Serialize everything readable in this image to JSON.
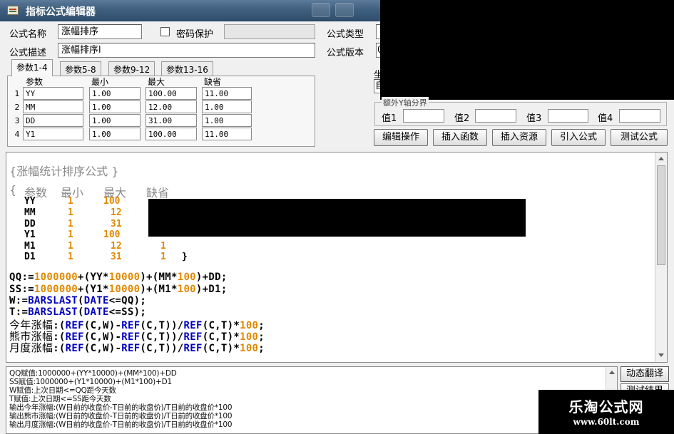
{
  "window": {
    "title": "指标公式编辑器"
  },
  "form": {
    "name_label": "公式名称",
    "name_value": "涨幅排序",
    "password_label": "密码保护",
    "type_label": "公式类型",
    "desc_label": "公式描述",
    "desc_value": "涨幅排序l",
    "version_label": "公式版本",
    "version_partial": "0",
    "side_label_partial": "坐",
    "side_field_partial": "自"
  },
  "tabs": [
    {
      "label": "参数1-4",
      "active": true
    },
    {
      "label": "参数5-8",
      "active": false
    },
    {
      "label": "参数9-12",
      "active": false
    },
    {
      "label": "参数13-16",
      "active": false
    }
  ],
  "params": {
    "headers": [
      "参数",
      "最小",
      "最大",
      "缺省"
    ],
    "rows": [
      {
        "num": "1",
        "name": "YY",
        "min": "1.00",
        "max": "100.00",
        "default": "11.00"
      },
      {
        "num": "2",
        "name": "MM",
        "min": "1.00",
        "max": "12.00",
        "default": "1.00"
      },
      {
        "num": "3",
        "name": "DD",
        "min": "1.00",
        "max": "31.00",
        "default": "1.00"
      },
      {
        "num": "4",
        "name": "Y1",
        "min": "1.00",
        "max": "100.00",
        "default": "11.00"
      }
    ]
  },
  "axis_group": {
    "legend": "额外Y轴分界",
    "values": [
      "值1",
      "值2",
      "值3",
      "值4"
    ]
  },
  "buttons": {
    "edit": "编辑操作",
    "insert_func": "插入函数",
    "insert_res": "插入资源",
    "import": "引入公式",
    "test": "测试公式",
    "dynamic_translate": "动态翻译",
    "test_result_partial": "测试结果"
  },
  "editor": {
    "comment_title": "{涨幅统计排序公式 }",
    "param_header": {
      "open": "{",
      "cols": [
        "参数",
        "最小",
        "最大",
        "缺省"
      ]
    },
    "param_rows": [
      {
        "name": "YY",
        "min": "1",
        "max": "100",
        "def": ""
      },
      {
        "name": "MM",
        "min": "1",
        "max": "12",
        "def": ""
      },
      {
        "name": "DD",
        "min": "1",
        "max": "31",
        "def": ""
      },
      {
        "name": "Y1",
        "min": "1",
        "max": "100",
        "def": ""
      },
      {
        "name": "M1",
        "min": "1",
        "max": "12",
        "def": "1"
      },
      {
        "name": "D1",
        "min": "1",
        "max": "31",
        "def": "1"
      }
    ],
    "param_close": "}",
    "code": {
      "qq": {
        "a": "QQ:=",
        "n1": "1000000",
        "b": "+(YY*",
        "n2": "10000",
        "c": ")+(MM*",
        "n3": "100",
        "d": ")+DD;"
      },
      "ss": {
        "a": "SS:=",
        "n1": "1000000",
        "b": "+(Y1*",
        "n2": "10000",
        "c": ")+(M1*",
        "n3": "100",
        "d": ")+D1;"
      },
      "w": {
        "a": "W:=",
        "f": "BARSLAST",
        "b": "(",
        "g": "DATE",
        "c": "<=QQ);"
      },
      "t": {
        "a": "T:=",
        "f": "BARSLAST",
        "b": "(",
        "g": "DATE",
        "c": "<=SS);"
      },
      "l1": {
        "cn": "今年涨幅",
        "a": ":(",
        "f1": "REF",
        "b": "(C,W)-",
        "f2": "REF",
        "c": "(C,T))/",
        "f3": "REF",
        "d": "(C,T)*",
        "n": "100",
        "e": ";"
      },
      "l2": {
        "cn": "熊市涨幅",
        "a": ":(",
        "f1": "REF",
        "b": "(C,W)-",
        "f2": "REF",
        "c": "(C,T))/",
        "f3": "REF",
        "d": "(C,T)*",
        "n": "100",
        "e": ";"
      },
      "l3": {
        "cn": "月度涨幅",
        "a": ":(",
        "f1": "REF",
        "b": "(C,W)-",
        "f2": "REF",
        "c": "(C,T))/",
        "f3": "REF",
        "d": "(C,T)*",
        "n": "100",
        "e": ";"
      }
    }
  },
  "output_lines": [
    "QQ赋值:1000000+(YY*10000)+(MM*100)+DD",
    "SS赋值:1000000+(Y1*10000)+(M1*100)+D1",
    "W赋值:上次日期<=QQ距今天数",
    "T赋值:上次日期<=SS距今天数",
    "输出今年涨幅:(W日前的收盘价-T日前的收盘价)/T日前的收盘价*100",
    "输出熊市涨幅:(W日前的收盘价-T日前的收盘价)/T日前的收盘价*100",
    "输出月度涨幅:(W日前的收盘价-T日前的收盘价)/T日前的收盘价*100"
  ],
  "watermark": {
    "title": "乐淘公式网",
    "url": "www.60lt.com"
  }
}
